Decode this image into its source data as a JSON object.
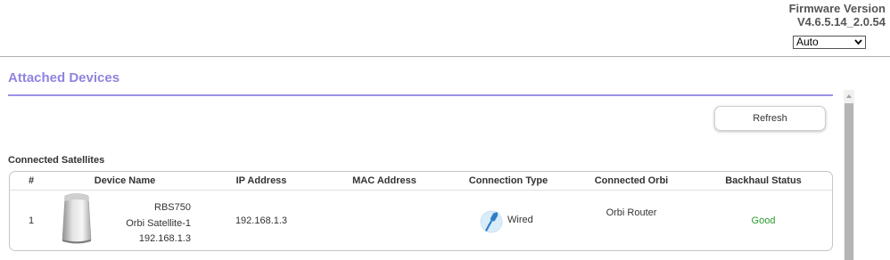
{
  "header": {
    "firmware_label": "Firmware Version",
    "firmware_version": "V4.6.5.14_2.0.54",
    "language_select": {
      "selected": "Auto",
      "icon": "chevron-down-icon"
    }
  },
  "page": {
    "title": "Attached Devices",
    "refresh_label": "Refresh"
  },
  "satellites": {
    "section_title": "Connected Satellites",
    "columns": [
      "#",
      "Device Name",
      "IP Address",
      "MAC Address",
      "Connection Type",
      "Connected Orbi",
      "Backhaul Status"
    ],
    "rows": [
      {
        "index": "1",
        "device_model": "RBS750",
        "device_name": "Orbi Satellite-1",
        "device_ip": "192.168.1.3",
        "ip_address": "192.168.1.3",
        "mac_address": "",
        "connection_type": "Wired",
        "connected_orbi": "Orbi Router",
        "backhaul_status": "Good",
        "device_icon": "orbi-satellite-icon",
        "connection_icon": "ethernet-cable-icon"
      }
    ]
  },
  "colors": {
    "accent": "#8e84e0",
    "good_status": "#2a9d2a"
  }
}
